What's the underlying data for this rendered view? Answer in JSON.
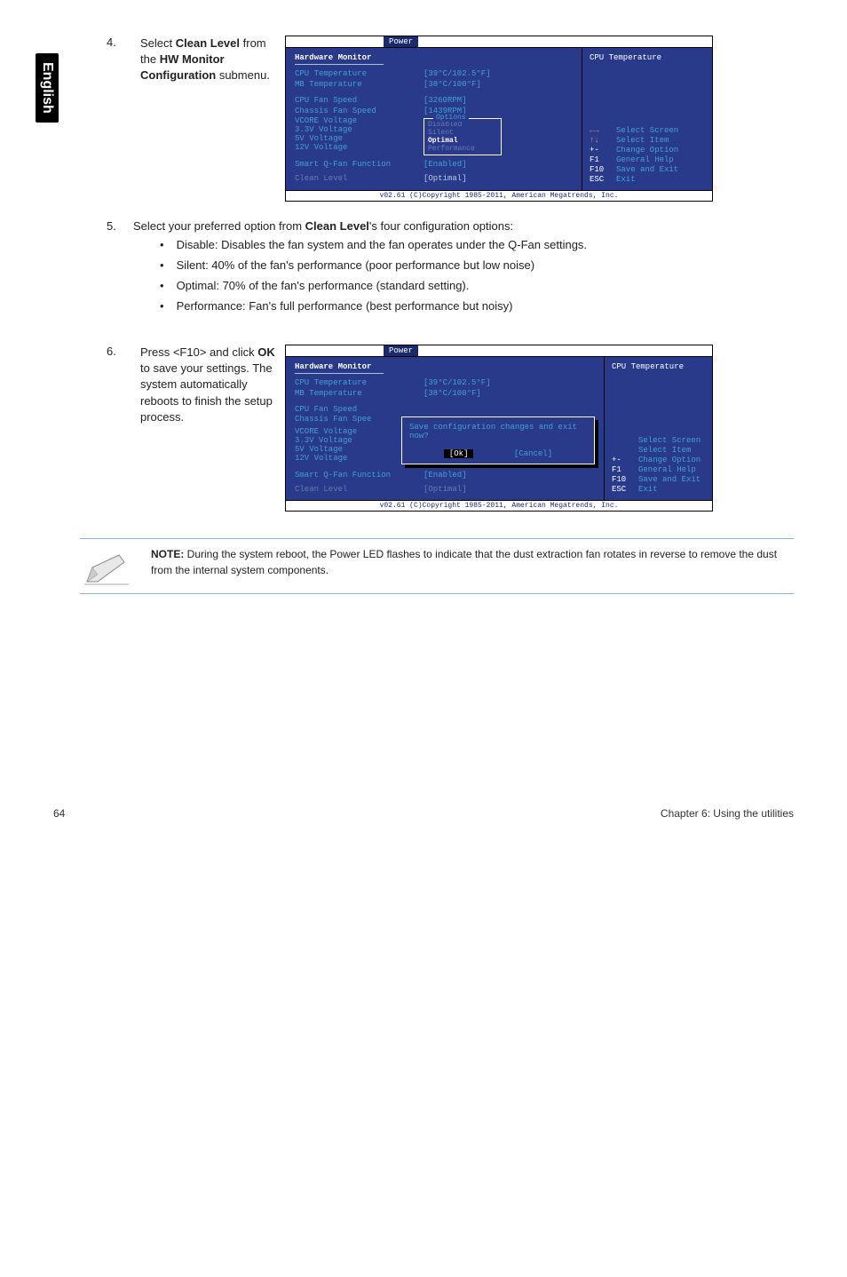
{
  "side_tab": "English",
  "step4": {
    "num": "4.",
    "text_parts": {
      "a": "Select ",
      "b": "Clean Level",
      "c": " from the ",
      "d": "HW Monitor Configuration",
      "e": " submenu."
    }
  },
  "step5": {
    "num": "5.",
    "intro_a": "Select your preferred option from ",
    "intro_b": "Clean Level",
    "intro_c": "'s four configuration options:",
    "items": [
      "Disable: Disables the fan system and the fan operates under the Q-Fan settings.",
      "Silent: 40% of the fan's performance (poor performance but low noise)",
      "Optimal: 70% of the fan's performance (standard setting).",
      "Performance: Fan's full performance (best performance but noisy)"
    ]
  },
  "step6": {
    "num": "6.",
    "text_a": "Press <F10> and click ",
    "text_b": "OK",
    "text_c": " to save your settings. The system automatically reboots to finish the setup process."
  },
  "bios": {
    "tab": "Power",
    "section": "Hardware Monitor",
    "cpu_temp": {
      "label": "CPU Temperature",
      "value": "[39°C/102.5°F]"
    },
    "mb_temp": {
      "label": "MB Temperature",
      "value": "[38°C/100°F]"
    },
    "cpu_fan": {
      "label": "CPU Fan Speed",
      "value": "[3260RPM]"
    },
    "chassis_fan": {
      "label": "Chassis Fan Speed",
      "value": "[1439RPM]"
    },
    "vcore": "VCORE Voltage",
    "v33": "3.3V Voltage",
    "v5": "5V Voltage",
    "v12": "12V Voltage",
    "qfan": {
      "label": "Smart Q-Fan Function",
      "value": "[Enabled]"
    },
    "clean": {
      "label": "Clean Level",
      "value": "[Optimal]"
    },
    "options_title": "Options",
    "opt_disabled": "Disabled",
    "opt_silent": "Silent",
    "opt_optimal": "Optimal",
    "opt_perf": "Performance",
    "right_title": "CPU Temperature",
    "help": {
      "select_screen": "Select Screen",
      "select_item": "Select Item",
      "change_opt": "Change Option",
      "gen_help": "General Help",
      "save_exit": "Save and Exit",
      "exit": "Exit",
      "k_pm": "+-",
      "k_f1": "F1",
      "k_f10": "F10",
      "k_esc": "ESC"
    },
    "footer": "v02.61 (C)Copyright 1985-2011, American Megatrends, Inc."
  },
  "bios2": {
    "chassis_fan_label": "Chassis Fan Spee",
    "modal_msg": "Save configuration changes and exit now?",
    "ok": "[Ok]",
    "cancel": "[Cancel]"
  },
  "note": {
    "label": "NOTE:",
    "text": " During the system reboot, the Power LED flashes to indicate that the dust extraction fan rotates in reverse to remove the dust from the internal system components."
  },
  "footer_left": "64",
  "footer_right": "Chapter 6: Using the utilities"
}
